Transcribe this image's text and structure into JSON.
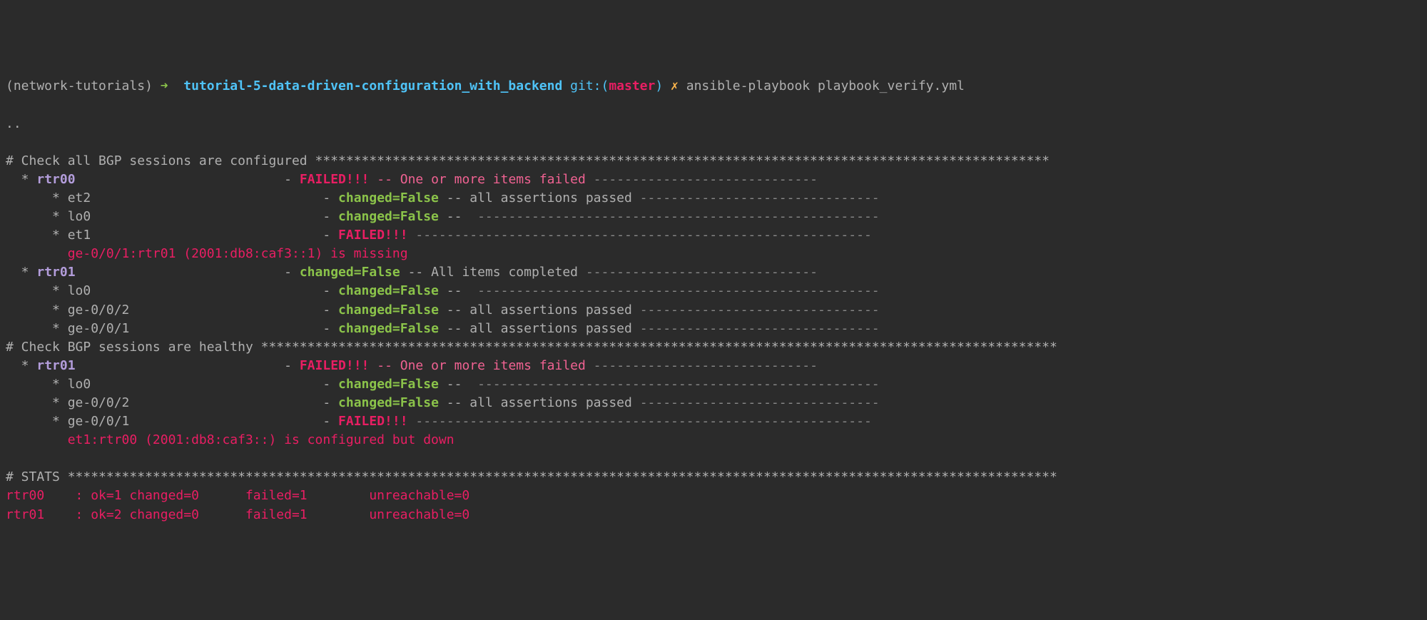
{
  "prompt": {
    "venv": "(network-tutorials)",
    "arrow": "➜",
    "dir": "tutorial-5-data-driven-configuration_with_backend",
    "git_label": "git:(",
    "git_paren_close": ")",
    "branch": "master",
    "dirty": "✗",
    "command": "ansible-playbook playbook_verify.yml"
  },
  "later": "..",
  "sections": [
    {
      "header": "# Check all BGP sessions are configured ***********************************************************************************************",
      "hosts": [
        {
          "bullet": "  * ",
          "name": "rtr00",
          "pad": "                           ",
          "dash": "- ",
          "status": "FAILED!!!",
          "status_color": "c-red",
          "sep": " -- ",
          "msg": "One or more items failed",
          "msg_color": "c-pink",
          "trail": " -----------------------------",
          "items": [
            {
              "bullet": "      * ",
              "name": "et2",
              "pad": "                              ",
              "dash": "- ",
              "status": "changed=False",
              "status_color": "c-green",
              "sep": " -- ",
              "msg": "all assertions passed",
              "msg_color": "c-grey",
              "trail": " -------------------------------"
            },
            {
              "bullet": "      * ",
              "name": "lo0",
              "pad": "                              ",
              "dash": "- ",
              "status": "changed=False",
              "status_color": "c-green",
              "sep": " --  ",
              "msg": "",
              "msg_color": "c-grey",
              "trail": "----------------------------------------------------"
            },
            {
              "bullet": "      * ",
              "name": "et1",
              "pad": "                              ",
              "dash": "- ",
              "status": "FAILED!!!",
              "status_color": "c-red",
              "sep": " ",
              "msg": "",
              "msg_color": "c-grey",
              "trail": "-----------------------------------------------------------"
            }
          ],
          "error_pad": "        ",
          "error": "ge-0/0/1:rtr01 (2001:db8:caf3::1) is missing"
        },
        {
          "bullet": "  * ",
          "name": "rtr01",
          "pad": "                           ",
          "dash": "- ",
          "status": "changed=False",
          "status_color": "c-green",
          "sep": " -- ",
          "msg": "All items completed",
          "msg_color": "c-grey",
          "trail": " ------------------------------",
          "items": [
            {
              "bullet": "      * ",
              "name": "lo0",
              "pad": "                              ",
              "dash": "- ",
              "status": "changed=False",
              "status_color": "c-green",
              "sep": " --  ",
              "msg": "",
              "msg_color": "c-grey",
              "trail": "----------------------------------------------------"
            },
            {
              "bullet": "      * ",
              "name": "ge-0/0/2",
              "pad": "                         ",
              "dash": "- ",
              "status": "changed=False",
              "status_color": "c-green",
              "sep": " -- ",
              "msg": "all assertions passed",
              "msg_color": "c-grey",
              "trail": " -------------------------------"
            },
            {
              "bullet": "      * ",
              "name": "ge-0/0/1",
              "pad": "                         ",
              "dash": "- ",
              "status": "changed=False",
              "status_color": "c-green",
              "sep": " -- ",
              "msg": "all assertions passed",
              "msg_color": "c-grey",
              "trail": " -------------------------------"
            }
          ],
          "error_pad": "",
          "error": ""
        }
      ]
    },
    {
      "header": "# Check BGP sessions are healthy *******************************************************************************************************",
      "hosts": [
        {
          "bullet": "  * ",
          "name": "rtr01",
          "pad": "                           ",
          "dash": "- ",
          "status": "FAILED!!!",
          "status_color": "c-red",
          "sep": " -- ",
          "msg": "One or more items failed",
          "msg_color": "c-pink",
          "trail": " -----------------------------",
          "items": [
            {
              "bullet": "      * ",
              "name": "lo0",
              "pad": "                              ",
              "dash": "- ",
              "status": "changed=False",
              "status_color": "c-green",
              "sep": " --  ",
              "msg": "",
              "msg_color": "c-grey",
              "trail": "----------------------------------------------------"
            },
            {
              "bullet": "      * ",
              "name": "ge-0/0/2",
              "pad": "                         ",
              "dash": "- ",
              "status": "changed=False",
              "status_color": "c-green",
              "sep": " -- ",
              "msg": "all assertions passed",
              "msg_color": "c-grey",
              "trail": " -------------------------------"
            },
            {
              "bullet": "      * ",
              "name": "ge-0/0/1",
              "pad": "                         ",
              "dash": "- ",
              "status": "FAILED!!!",
              "status_color": "c-red",
              "sep": " ",
              "msg": "",
              "msg_color": "c-grey",
              "trail": "-----------------------------------------------------------"
            }
          ],
          "error_pad": "        ",
          "error": "et1:rtr00 (2001:db8:caf3::) is configured but down"
        }
      ]
    }
  ],
  "stats": {
    "header": "# STATS ********************************************************************************************************************************",
    "rows": [
      {
        "host": "rtr00",
        "rest": "    : ok=1 changed=0      failed=1        unreachable=0"
      },
      {
        "host": "rtr01",
        "rest": "    : ok=2 changed=0      failed=1        unreachable=0"
      }
    ]
  }
}
